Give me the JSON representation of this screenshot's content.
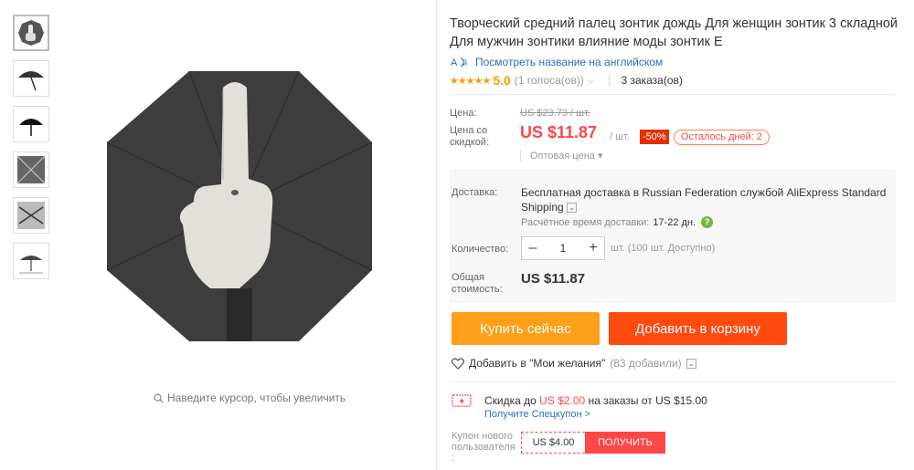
{
  "gallery": {
    "thumbnails": [
      "thumb-1",
      "thumb-2",
      "thumb-3",
      "thumb-4",
      "thumb-5",
      "thumb-6"
    ],
    "zoom_hint": "Наведите курсор, чтобы увеличить"
  },
  "product": {
    "title": "Творческий средний палец зонтик дождь Для женщин зонтик 3 складной Для мужчин зонтики влияние моды зонтик E",
    "translate_link": "Посмотреть название на английском",
    "rating_stars": "★★★★★",
    "rating_value": "5.0",
    "votes": "(1 голоса(ов))",
    "orders": "3 заказа(ов)"
  },
  "price": {
    "label": "Цена:",
    "old": "US $23.73 / шт.",
    "discount_label": "Цена со скидкой:",
    "current": "US $11.87",
    "per_unit": "/ шт.",
    "percent_off": "-50%",
    "days_left": "Осталось дней: 2",
    "wholesale": "Оптовая цена ▾"
  },
  "shipping": {
    "label": "Доставка:",
    "text": "Бесплатная доставка в Russian Federation службой AliExpress Standard Shipping",
    "eta_label": "Расчётное время доставки:",
    "eta_value": "17-22 дн."
  },
  "quantity": {
    "label": "Количество:",
    "minus": "–",
    "value": "1",
    "plus": "+",
    "available": "шт. (100 шт. Доступно)"
  },
  "total": {
    "label": "Общая стоимость:",
    "value": "US $11.87"
  },
  "actions": {
    "buy_now": "Купить сейчас",
    "add_to_cart": "Добавить в корзину",
    "wishlist": "Добавить в \"Мои желания\"",
    "wishlist_count": "(83 добавили)"
  },
  "coupon": {
    "deal_prefix": "Скидка до",
    "deal_amount": "US $2.00",
    "deal_suffix": "на заказы от US $15.00",
    "deal_link": "Получите Спецкупон >",
    "new_user_label": "Купон нового пользователя :",
    "new_user_amount": "US $4.00",
    "get_button": "ПОЛУЧИТЬ"
  },
  "colors": {
    "accent_red": "#ff4747",
    "buy_orange": "#ff9f1a",
    "cart_red": "#ff4a10",
    "link_blue": "#2a6ebb",
    "star_orange": "#ff9900"
  }
}
